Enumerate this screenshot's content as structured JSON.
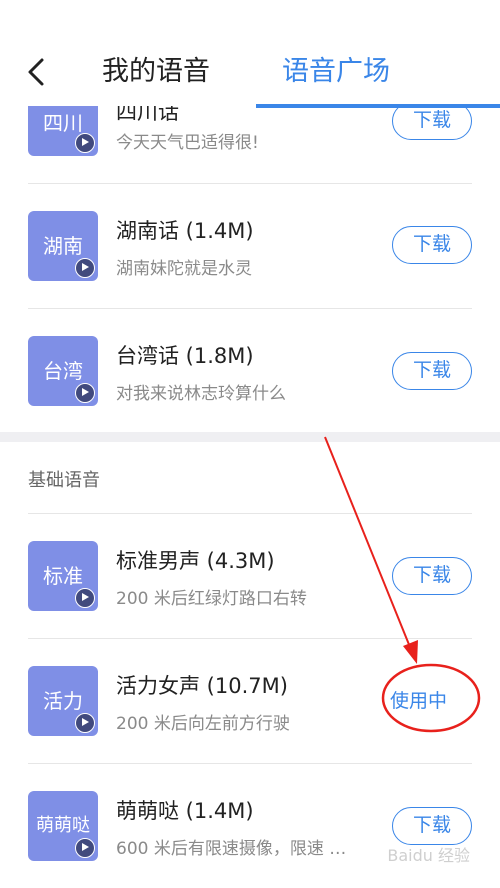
{
  "header": {
    "tab_mine": "我的语音",
    "tab_square": "语音广场"
  },
  "dialects": [
    {
      "thumb": "四川",
      "title": "四川话",
      "desc": "今天天气巴适得很!",
      "action": "下载"
    },
    {
      "thumb": "湖南",
      "title": "湖南话 (1.4M)",
      "desc": "湖南妹陀就是水灵",
      "action": "下载"
    },
    {
      "thumb": "台湾",
      "title": "台湾话 (1.8M)",
      "desc": "对我来说林志玲算什么",
      "action": "下载"
    }
  ],
  "basic_section": {
    "title": "基础语音",
    "items": [
      {
        "thumb": "标准",
        "title": "标准男声 (4.3M)",
        "desc": "200 米后红绿灯路口右转",
        "action": "下载"
      },
      {
        "thumb": "活力",
        "title": "活力女声 (10.7M)",
        "desc": "200 米后向左前方行驶",
        "status": "使用中"
      },
      {
        "thumb": "萌萌哒",
        "title": "萌萌哒 (1.4M)",
        "desc": "600 米后有限速摄像，限速 …",
        "action": "下载"
      }
    ]
  },
  "watermark": "Baidu 经验",
  "colors": {
    "accent": "#3a86e8",
    "thumb_bg": "#7f8fe6",
    "annotation": "#e8211c"
  },
  "icons": {
    "back": "chevron-left",
    "play": "play-circle"
  }
}
